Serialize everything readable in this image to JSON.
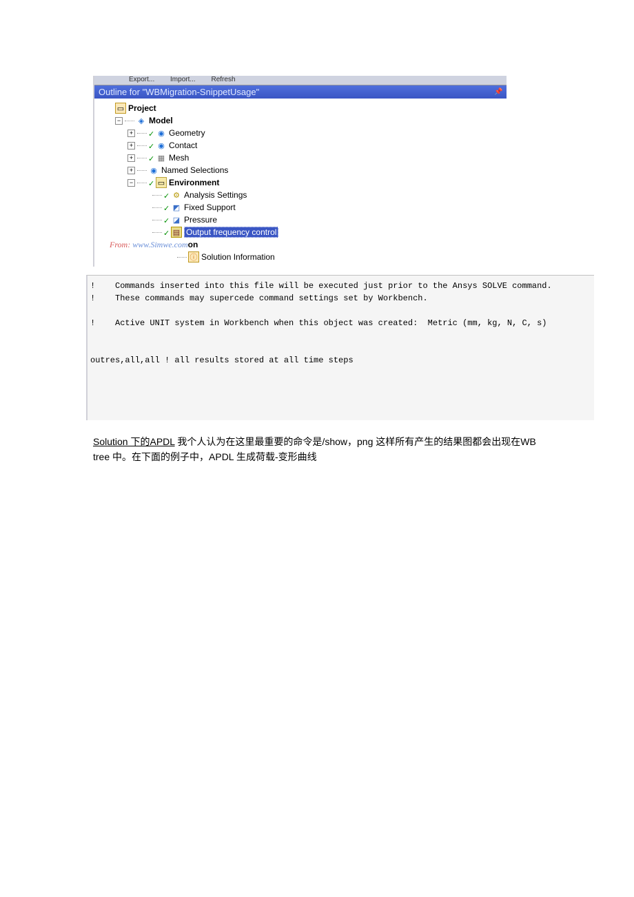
{
  "toolbar": {
    "export": "Export...",
    "import": "Import...",
    "refresh": "Refresh"
  },
  "outline": {
    "title": "Outline for \"WBMigration-SnippetUsage\"",
    "tree": {
      "project": "Project",
      "model": "Model",
      "geometry": "Geometry",
      "contact": "Contact",
      "mesh": "Mesh",
      "namedSelections": "Named Selections",
      "environment": "Environment",
      "analysisSettings": "Analysis Settings",
      "fixedSupport": "Fixed Support",
      "pressure": "Pressure",
      "outputFreq": "Output frequency control",
      "solutionSuffix": "on",
      "solutionInfo": "Solution Information"
    },
    "watermark": {
      "from": "From:",
      "site": "www.Simwe.com"
    }
  },
  "code": {
    "line1": "!    Commands inserted into this file will be executed just prior to the Ansys SOLVE command.",
    "line2": "!    These commands may supercede command settings set by Workbench.",
    "line3": "",
    "line4": "!    Active UNIT system in Workbench when this object was created:  Metric (mm, kg, N, C, s)",
    "line5": "",
    "line6": "",
    "line7": "outres,all,all ! all results stored at all time steps"
  },
  "bodyText": {
    "part1_underlined": "Solution 下的APDL",
    "part1_rest": " 我个人认为在这里最重要的命令是/show，png 这样所有产生的结果图都会出现在WB tree 中。在下面的例子中，APDL 生成荷载-变形曲线"
  }
}
